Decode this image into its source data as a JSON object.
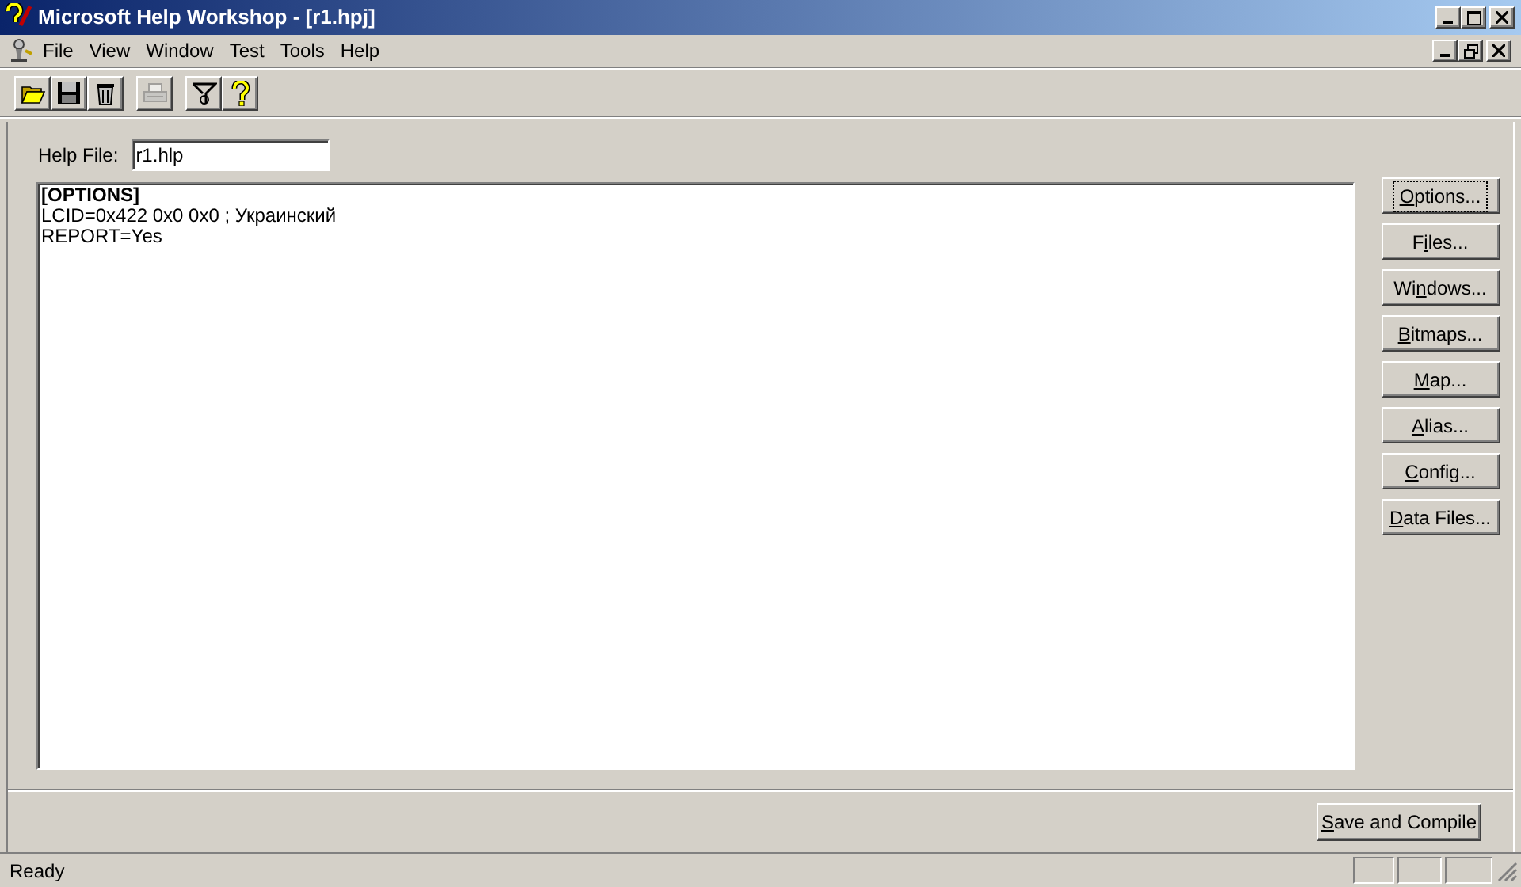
{
  "window": {
    "title": "Microsoft Help Workshop - [r1.hpj]"
  },
  "menu": [
    {
      "label": "File"
    },
    {
      "label": "View"
    },
    {
      "label": "Window"
    },
    {
      "label": "Test"
    },
    {
      "label": "Tools"
    },
    {
      "label": "Help"
    }
  ],
  "toolbar": [
    {
      "kind": "open",
      "disabled": false
    },
    {
      "kind": "save",
      "disabled": false
    },
    {
      "kind": "delete",
      "disabled": false
    },
    {
      "kind": "print",
      "disabled": true
    },
    {
      "kind": "compile",
      "disabled": false
    },
    {
      "kind": "help",
      "disabled": false
    }
  ],
  "help_file": {
    "label": "Help File:",
    "value": "r1.hlp"
  },
  "editor_lines": [
    {
      "text": "[OPTIONS]",
      "bold": true
    },
    {
      "text": "LCID=0x422 0x0 0x0 ; Украинский",
      "bold": false
    },
    {
      "text": "REPORT=Yes",
      "bold": false
    }
  ],
  "side_buttons": [
    {
      "access_key": "O",
      "after": "ptions...",
      "focused": true
    },
    {
      "before": "F",
      "access_key": "i",
      "after": "les...",
      "focused": false
    },
    {
      "before": "Wi",
      "access_key": "n",
      "after": "dows...",
      "focused": false
    },
    {
      "access_key": "B",
      "after": "itmaps...",
      "focused": false
    },
    {
      "access_key": "M",
      "after": "ap...",
      "focused": false
    },
    {
      "access_key": "A",
      "after": "lias...",
      "focused": false
    },
    {
      "access_key": "C",
      "after": "onfig...",
      "focused": false
    },
    {
      "access_key": "D",
      "after": "ata Files...",
      "focused": false
    }
  ],
  "save_button": {
    "access_key": "S",
    "after": "ave and Compile"
  },
  "status_bar": {
    "text": "Ready"
  }
}
